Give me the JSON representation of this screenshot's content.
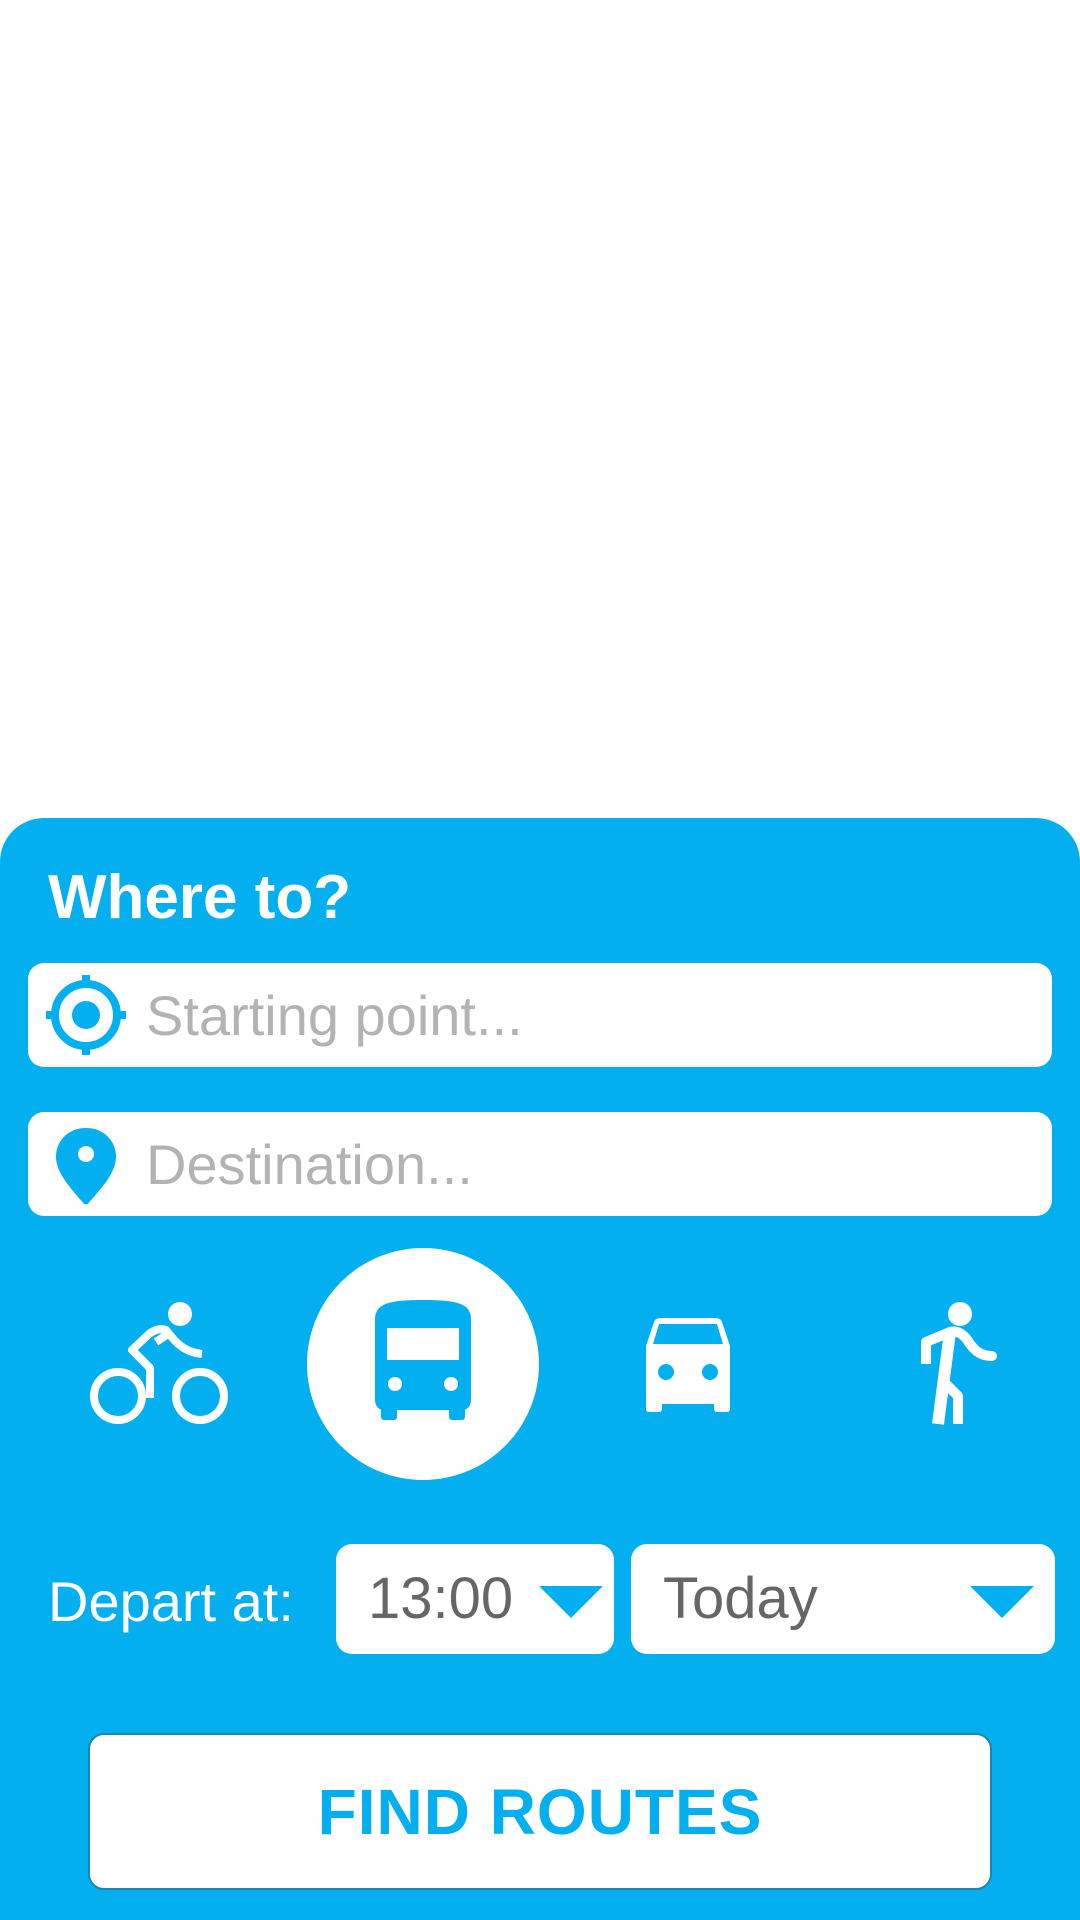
{
  "theme": {
    "accent": "#04aff0",
    "surface": "#ffffff",
    "placeholder_text": "#b3b3b3",
    "value_text": "#666666"
  },
  "panel": {
    "title": "Where to?"
  },
  "start_field": {
    "icon": "gps-target-icon",
    "value": "",
    "placeholder": "Starting point..."
  },
  "destination_field": {
    "icon": "map-pin-icon",
    "value": "",
    "placeholder": "Destination..."
  },
  "travel_modes": {
    "selected": "bus",
    "items": [
      {
        "id": "bike",
        "icon": "bicycle-icon"
      },
      {
        "id": "bus",
        "icon": "bus-icon"
      },
      {
        "id": "car",
        "icon": "car-icon"
      },
      {
        "id": "walk",
        "icon": "walking-icon"
      }
    ]
  },
  "depart": {
    "label": "Depart at:",
    "time": "13:00",
    "day": "Today",
    "dropdown_icon": "caret-down-icon"
  },
  "find_button": {
    "label": "FIND ROUTES"
  }
}
